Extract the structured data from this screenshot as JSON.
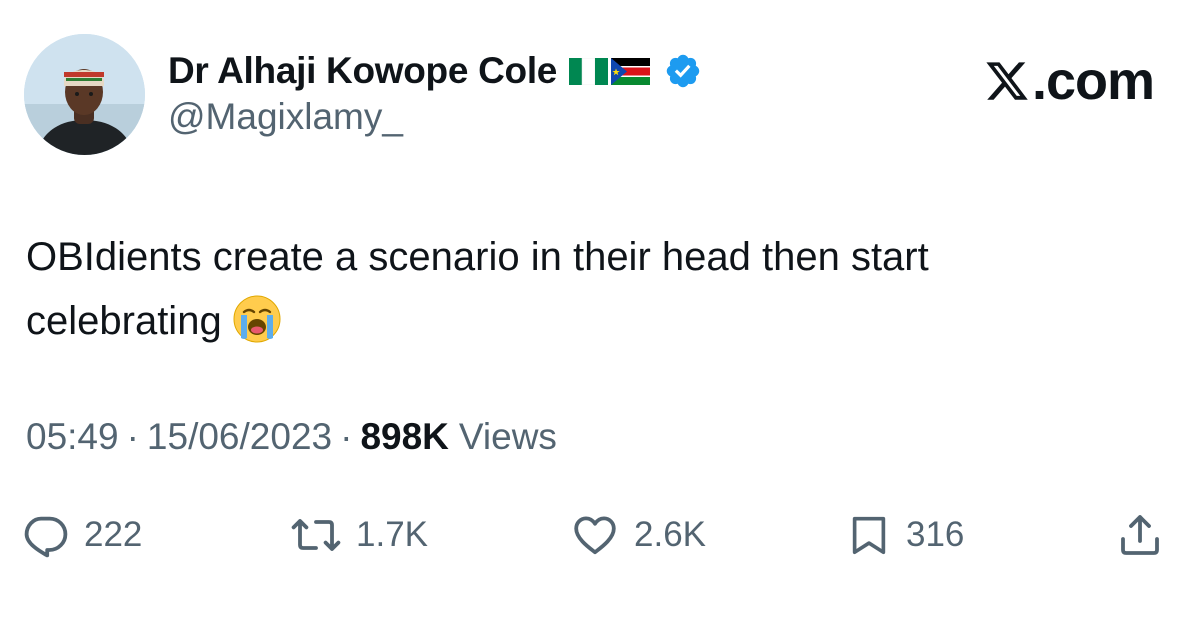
{
  "author": {
    "display_name": "Dr Alhaji Kowope Cole",
    "handle": "@Magixlamy_",
    "flags": [
      "nigeria-flag-icon",
      "south-sudan-flag-icon"
    ],
    "verified_icon": "verified-badge-icon",
    "verified_color": "#1d9bf0"
  },
  "brand": {
    "label_suffix": ".com",
    "icon": "x-logo-icon"
  },
  "tweet": {
    "text_line1": "OBIdients create a scenario in their head then start",
    "text_line2": "celebrating",
    "emoji": "loudly-crying-face-icon"
  },
  "meta": {
    "time": "05:49",
    "separator": "·",
    "date": "15/06/2023",
    "views_count": "898K",
    "views_label": "Views"
  },
  "actions": {
    "replies": "222",
    "reposts": "1.7K",
    "likes": "2.6K",
    "bookmarks": "316"
  },
  "colors": {
    "text_primary": "#0f1419",
    "text_secondary": "#536471",
    "verified": "#1d9bf0"
  }
}
